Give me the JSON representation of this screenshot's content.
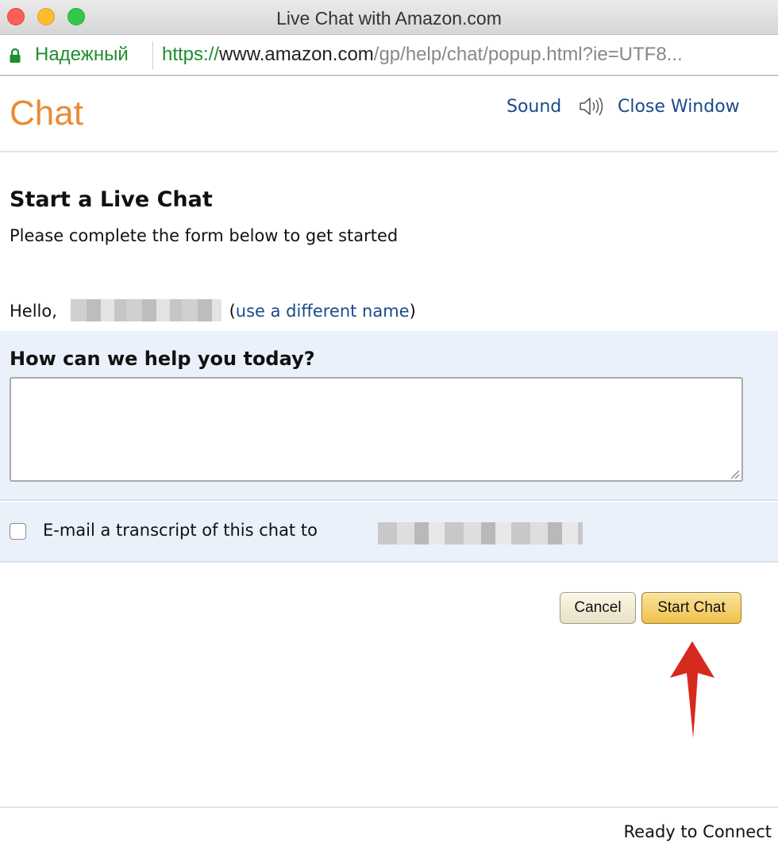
{
  "window": {
    "title": "Live Chat with Amazon.com"
  },
  "address_bar": {
    "secure_label": "Надежный",
    "url_scheme": "https://",
    "url_host": "www.amazon.com",
    "url_path": "/gp/help/chat/popup.html?ie=UTF8..."
  },
  "header": {
    "title": "Chat",
    "sound_label": "Sound",
    "close_label": "Close Window"
  },
  "intro": {
    "heading": "Start a Live Chat",
    "subheading": "Please complete the form below to get started"
  },
  "greeting": {
    "hello": "Hello,",
    "paren_open": "(",
    "different_name_link": "use a different name",
    "paren_close": ")"
  },
  "help": {
    "label": "How can we help you today?",
    "value": ""
  },
  "email": {
    "label": "E-mail a transcript of this chat to",
    "checked": false
  },
  "buttons": {
    "cancel": "Cancel",
    "start_chat": "Start Chat"
  },
  "status": "Ready to Connect",
  "colors": {
    "accent_orange": "#e47911",
    "link_blue": "#1b4a8a",
    "section_bg": "#eaf1fa",
    "arrow_red": "#d62a1e",
    "start_button": "#f0c14b"
  }
}
